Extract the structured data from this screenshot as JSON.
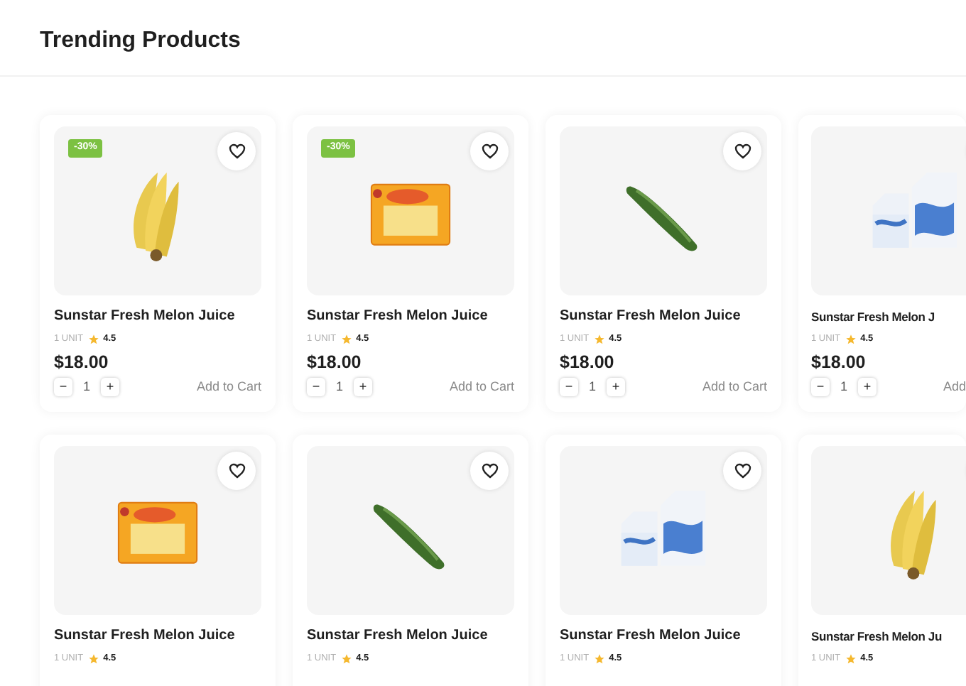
{
  "title": "Trending Products",
  "products": [
    {
      "kind": "banana",
      "badge": "-30%",
      "name": "Sunstar Fresh Melon Juice",
      "unit": "1 UNIT",
      "rating": "4.5",
      "price": "$18.00",
      "minus": "−",
      "quantity": "1",
      "plus": "+",
      "cart": "Add to Cart"
    },
    {
      "kind": "box",
      "badge": "-30%",
      "name": "Sunstar Fresh Melon Juice",
      "unit": "1 UNIT",
      "rating": "4.5",
      "price": "$18.00",
      "minus": "−",
      "quantity": "1",
      "plus": "+",
      "cart": "Add to Cart"
    },
    {
      "kind": "cucumber",
      "name": "Sunstar Fresh Melon Juice",
      "unit": "1 UNIT",
      "rating": "4.5",
      "price": "$18.00",
      "minus": "−",
      "quantity": "1",
      "plus": "+",
      "cart": "Add to Cart"
    },
    {
      "kind": "milk",
      "name": "Sunstar Fresh Melon J",
      "unit": "1 UNIT",
      "rating": "4.5",
      "price": "$18.00",
      "minus": "−",
      "quantity": "1",
      "plus": "+",
      "cart": "Add"
    },
    {
      "kind": "box",
      "name": "Sunstar Fresh Melon Juice",
      "unit": "1 UNIT",
      "rating": "4.5"
    },
    {
      "kind": "cucumber",
      "name": "Sunstar Fresh Melon Juice",
      "unit": "1 UNIT",
      "rating": "4.5"
    },
    {
      "kind": "milk",
      "name": "Sunstar Fresh Melon Juice",
      "unit": "1 UNIT",
      "rating": "4.5"
    },
    {
      "kind": "banana",
      "name": "Sunstar Fresh Melon Ju",
      "unit": "1 UNIT",
      "rating": "4.5"
    }
  ]
}
